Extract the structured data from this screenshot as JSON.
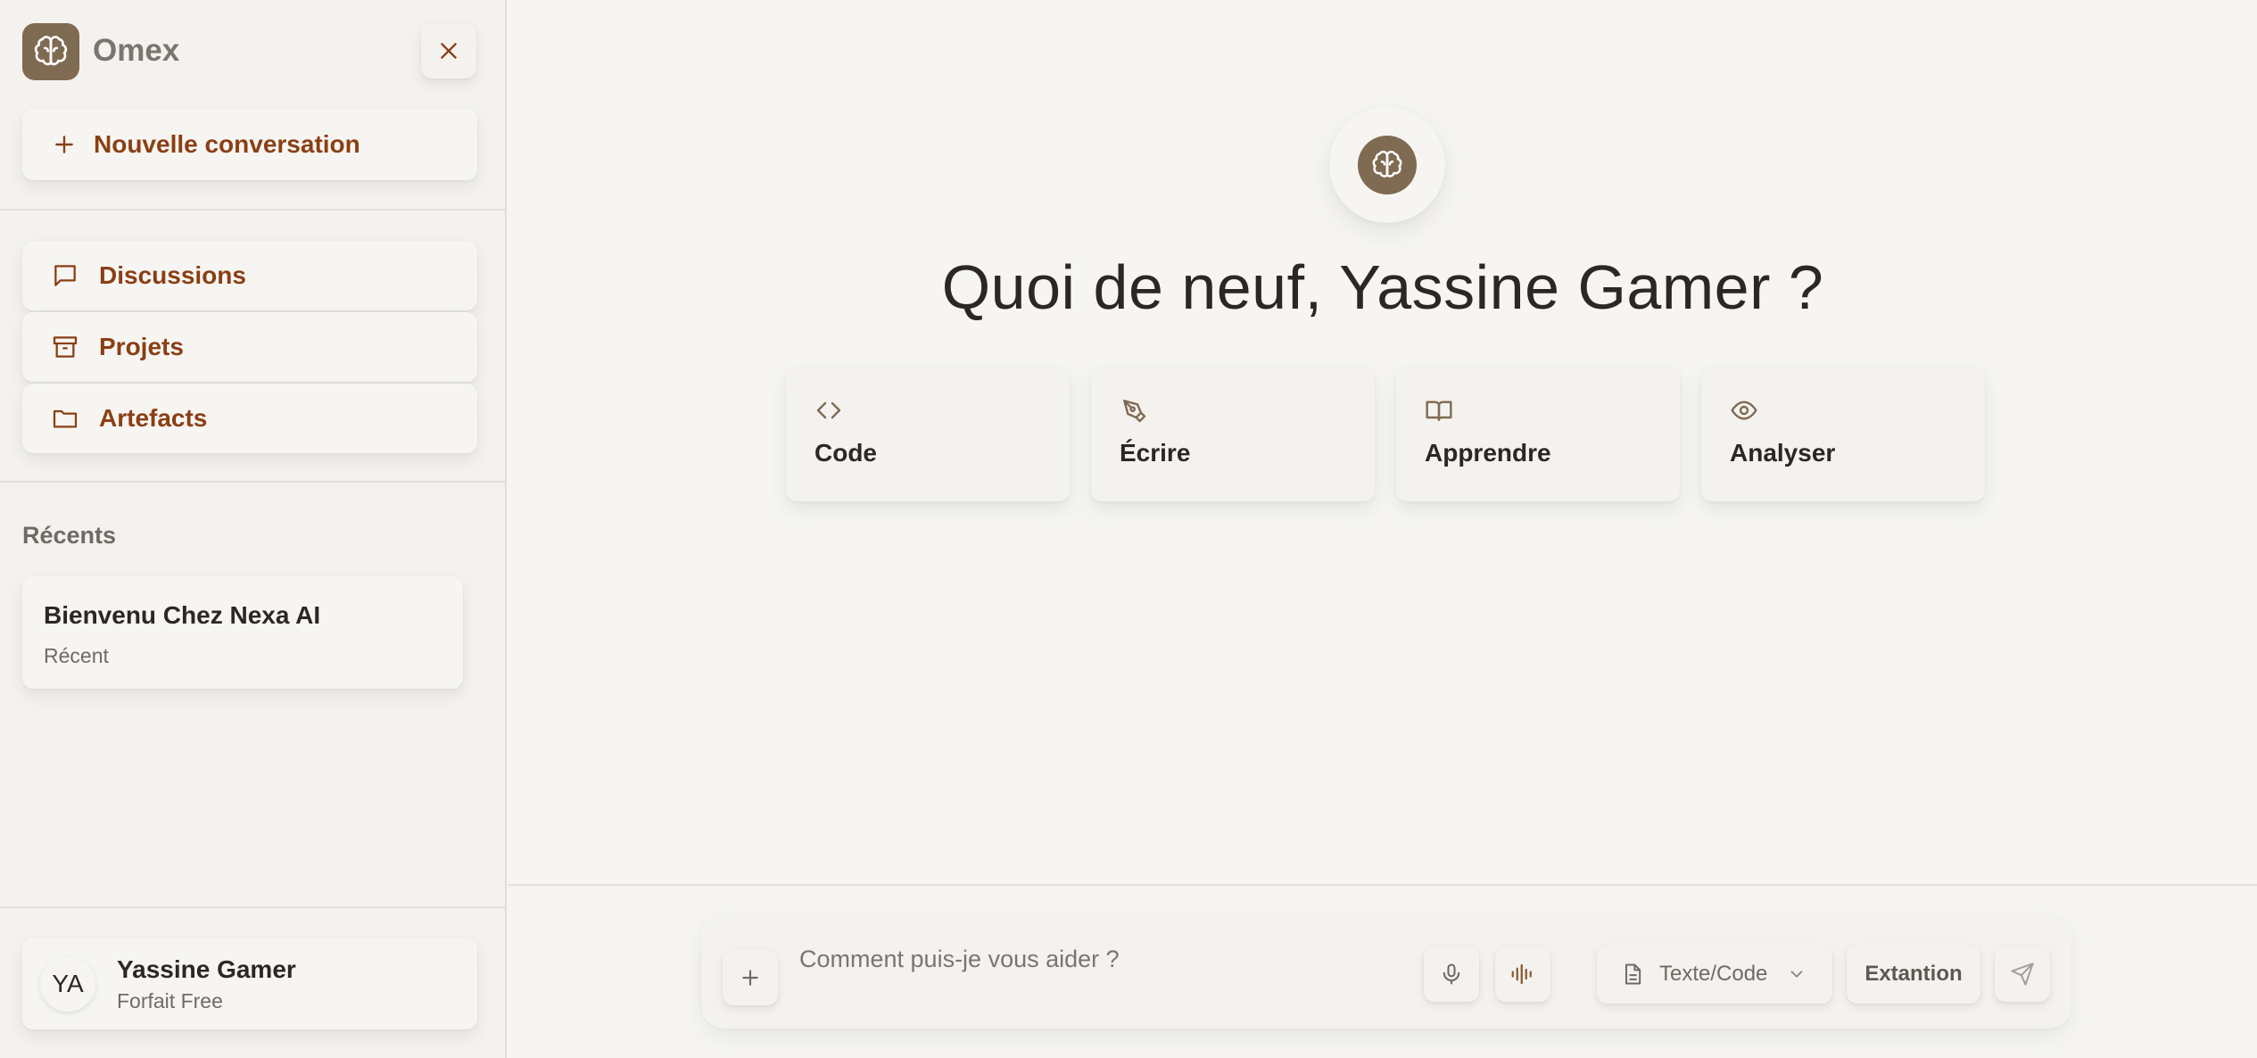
{
  "colors": {
    "accent": "#8a3f14",
    "brand": "#7f6a52",
    "background": "#f6f5f2",
    "sidebar_bg": "#f4f2ee",
    "muted_text": "#6f6a64"
  },
  "sidebar": {
    "brand_name": "Omex",
    "brand_icon": "brain-icon",
    "close_icon": "close-icon",
    "new_conversation": {
      "label": "Nouvelle conversation",
      "icon": "plus-icon"
    },
    "nav": [
      {
        "label": "Discussions",
        "icon": "message-square-icon"
      },
      {
        "label": "Projets",
        "icon": "archive-icon"
      },
      {
        "label": "Artefacts",
        "icon": "folder-icon"
      }
    ],
    "recents_title": "Récents",
    "recents": [
      {
        "title": "Bienvenu Chez Nexa AI",
        "subtitle": "Récent"
      }
    ],
    "user": {
      "initials": "YA",
      "name": "Yassine Gamer",
      "plan": "Forfait Free"
    }
  },
  "main": {
    "greeting": "Quoi de neuf, Yassine Gamer ?",
    "actions": [
      {
        "label": "Code",
        "icon": "code-icon"
      },
      {
        "label": "Écrire",
        "icon": "pen-tool-icon"
      },
      {
        "label": "Apprendre",
        "icon": "book-open-icon"
      },
      {
        "label": "Analyser",
        "icon": "eye-icon"
      }
    ]
  },
  "composer": {
    "placeholder": "Comment puis-je vous aider ?",
    "value": "",
    "mode_label": "Texte/Code",
    "extension_label": "Extantion"
  }
}
